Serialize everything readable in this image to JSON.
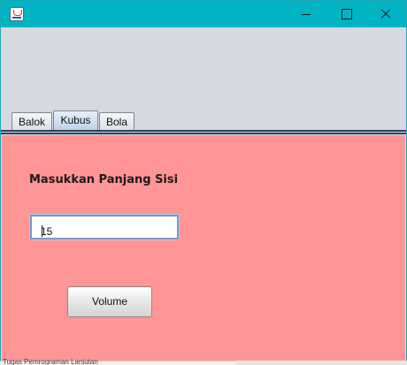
{
  "window": {
    "title": "",
    "controls": [
      "minimize-icon",
      "maximize-icon",
      "close-icon"
    ]
  },
  "tabs": [
    {
      "label": "Balok",
      "active": false
    },
    {
      "label": "Kubus",
      "active": true
    },
    {
      "label": "Bola",
      "active": false
    }
  ],
  "form": {
    "prompt_label": "Masukkan Panjang Sisi",
    "side_value": "15",
    "button_label": "Volume"
  },
  "colors": {
    "titlebar": "#00b4c4",
    "panel": "#ff9595"
  },
  "taskbar": {
    "text": "Tugas Pemrograman Lanjutan"
  }
}
